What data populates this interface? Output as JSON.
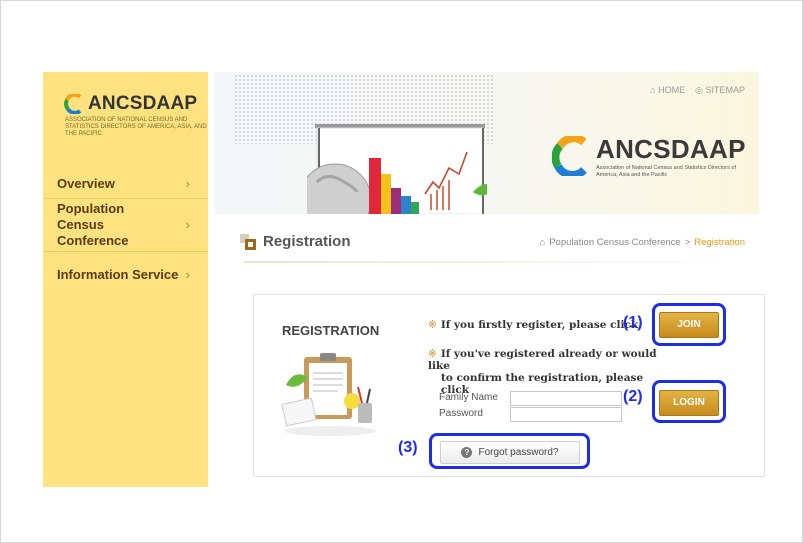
{
  "sidebar": {
    "logo_title": "ANCSDAAP",
    "logo_subtitle": "ASSOCIATION OF NATIONAL CENSUS AND STATISTICS DIRECTORS OF AMERICA, ASIA, AND THE PACIFIC",
    "items": [
      {
        "label": "Overview"
      },
      {
        "label": "Population Census Conference"
      },
      {
        "label": "Information Service"
      }
    ]
  },
  "header": {
    "home": "HOME",
    "sitemap": "SITEMAP",
    "brand_title": "ANCSDAAP",
    "brand_subtitle": "Association of National Census and Statistics Directors of America, Asia and the Pacific"
  },
  "page": {
    "title": "Registration",
    "breadcrumb_parent": "Population Census Conference",
    "breadcrumb_sep": ">",
    "breadcrumb_current": "Registration"
  },
  "registration": {
    "heading": "REGISTRATION",
    "first_register_text": "If you firstly register, please click",
    "already_line1": "If you've registered already or would like",
    "already_line2": "to confirm the registration, please click",
    "join_label": "JOIN",
    "login_label": "LOGIN",
    "family_name_label": "Family Name",
    "password_label": "Password",
    "family_name_value": "",
    "password_value": "",
    "forgot_label": "Forgot password?"
  },
  "annotations": {
    "a1": "(1)",
    "a2": "(2)",
    "a3": "(3)"
  },
  "colors": {
    "sidebar_bg": "#fde27f",
    "button_gold": "#c78a1c",
    "annotation_blue": "#1e2ee6",
    "breadcrumb_accent": "#e79a16"
  },
  "icons": [
    "home-icon",
    "sitemap-icon",
    "chevron-right-icon",
    "help-icon",
    "registration-icon"
  ]
}
